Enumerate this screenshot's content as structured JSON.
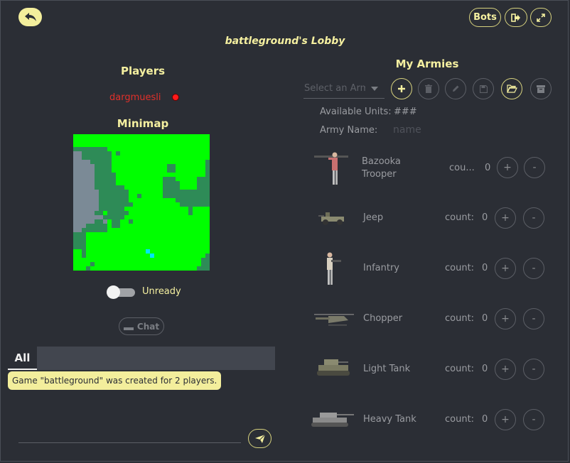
{
  "header": {
    "title": "battleground's Lobby",
    "bots_label": "Bots"
  },
  "players": {
    "heading": "Players",
    "list": [
      {
        "name": "dargmuesli",
        "status_color": "#ff1a1a"
      }
    ]
  },
  "minimap": {
    "heading": "Minimap",
    "colors": {
      "grass": "#00ff00",
      "forest": "#2e8b57",
      "water": "#7b8a96",
      "unit": "#00e5ff"
    }
  },
  "ready_toggle": {
    "label": "Unready",
    "checked": false
  },
  "chat_button": {
    "label": "Chat"
  },
  "chat": {
    "tab_label": "All",
    "messages": [
      "Game \"battleground\" was created for 2 players."
    ],
    "input_value": ""
  },
  "armies": {
    "heading": "My Armies",
    "select_placeholder": "Select an Army",
    "available_units_label": "Available Units:",
    "available_units_value": "###",
    "army_name_label": "Army Name:",
    "army_name_placeholder": "name",
    "units": [
      {
        "name": "Bazooka Trooper",
        "count_label": "cou...",
        "count": "0"
      },
      {
        "name": "Jeep",
        "count_label": "count:",
        "count": "0"
      },
      {
        "name": "Infantry",
        "count_label": "count:",
        "count": "0"
      },
      {
        "name": "Chopper",
        "count_label": "count:",
        "count": "0"
      },
      {
        "name": "Light Tank",
        "count_label": "count:",
        "count": "0"
      },
      {
        "name": "Heavy Tank",
        "count_label": "count:",
        "count": "0"
      }
    ],
    "plus_label": "+",
    "minus_label": "-"
  },
  "accent_color": "#f5f0a0"
}
